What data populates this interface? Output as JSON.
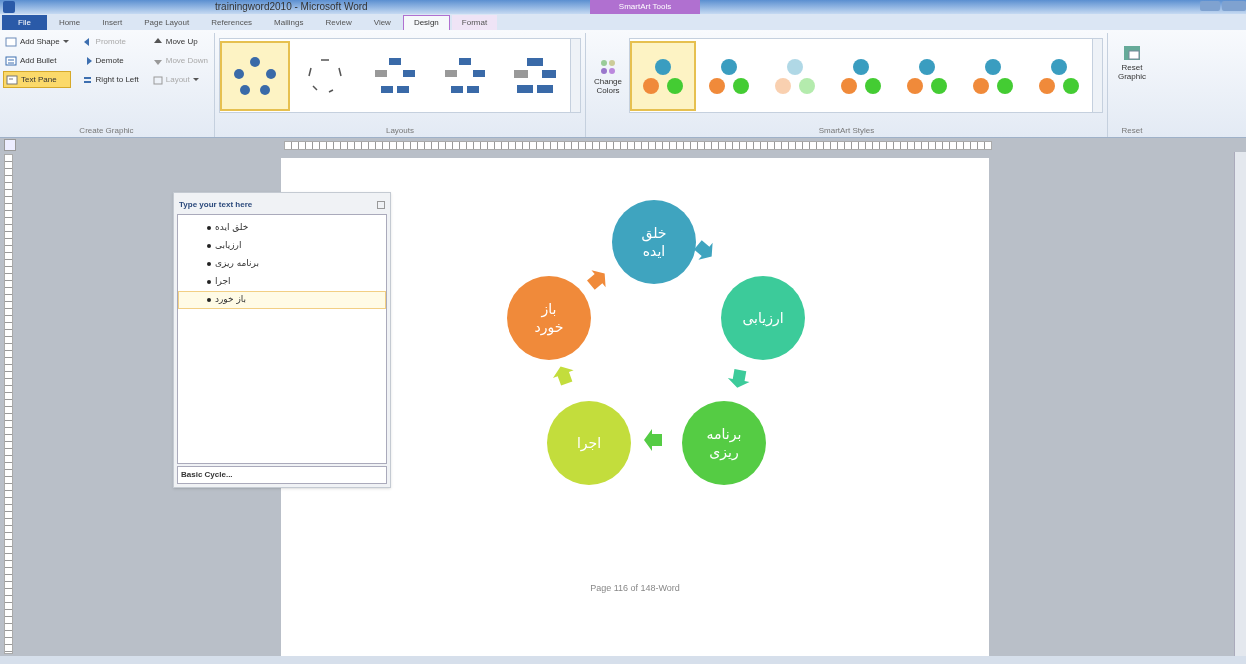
{
  "window": {
    "title": "trainingword2010 - Microsoft Word",
    "context_tab_group": "SmartArt Tools"
  },
  "tabs": [
    {
      "label": "File",
      "kind": "file",
      "selected": false
    },
    {
      "label": "Home",
      "kind": "tab",
      "selected": false
    },
    {
      "label": "Insert",
      "kind": "tab",
      "selected": false
    },
    {
      "label": "Page Layout",
      "kind": "tab",
      "selected": false
    },
    {
      "label": "References",
      "kind": "tab",
      "selected": false
    },
    {
      "label": "Mailings",
      "kind": "tab",
      "selected": false
    },
    {
      "label": "Review",
      "kind": "tab",
      "selected": false
    },
    {
      "label": "View",
      "kind": "tab",
      "selected": false
    },
    {
      "label": "Design",
      "kind": "context",
      "selected": true
    },
    {
      "label": "Format",
      "kind": "context",
      "selected": false
    }
  ],
  "ribbon": {
    "create_graphic": {
      "label": "Create Graphic",
      "columns": [
        [
          {
            "label": "Add Shape",
            "dropdown": true,
            "disabled": false,
            "selected": false
          },
          {
            "label": "Add Bullet",
            "dropdown": false,
            "disabled": false,
            "selected": false
          },
          {
            "label": "Text Pane",
            "dropdown": false,
            "disabled": false,
            "selected": true
          }
        ],
        [
          {
            "label": "Promote",
            "dropdown": false,
            "disabled": true,
            "selected": false
          },
          {
            "label": "Demote",
            "dropdown": false,
            "disabled": false,
            "selected": false
          },
          {
            "label": "Right to Left",
            "dropdown": false,
            "disabled": false,
            "selected": false
          }
        ],
        [
          {
            "label": "Move Up",
            "dropdown": false,
            "disabled": false,
            "selected": false
          },
          {
            "label": "Move Down",
            "dropdown": false,
            "disabled": true,
            "selected": false
          },
          {
            "label": "Layout",
            "dropdown": true,
            "disabled": true,
            "selected": false
          }
        ]
      ]
    },
    "layouts": {
      "label": "Layouts",
      "items": [
        {
          "kind": "cycle",
          "selected": true
        },
        {
          "kind": "arrows",
          "selected": false
        },
        {
          "kind": "blocks",
          "selected": false
        },
        {
          "kind": "blocks",
          "selected": false
        },
        {
          "kind": "wide",
          "selected": false
        }
      ]
    },
    "styles": {
      "label": "SmartArt Styles",
      "change_colors": "Change Colors",
      "items": [
        {
          "kind": "flat",
          "selected": true
        },
        {
          "kind": "flat",
          "selected": false
        },
        {
          "kind": "pale",
          "selected": false
        },
        {
          "kind": "flat",
          "selected": false
        },
        {
          "kind": "flat",
          "selected": false
        },
        {
          "kind": "flat",
          "selected": false
        },
        {
          "kind": "flat",
          "selected": false
        }
      ]
    },
    "reset": {
      "label": "Reset",
      "button": "Reset Graphic"
    }
  },
  "text_pane": {
    "title": "Type your text here",
    "items": [
      {
        "text": "خلق ایده",
        "selected": false
      },
      {
        "text": "ارزیابی",
        "selected": false
      },
      {
        "text": "برنامه ریزی",
        "selected": false
      },
      {
        "text": "اجرا",
        "selected": false
      },
      {
        "text": "باز خورد",
        "selected": true
      }
    ],
    "footer": "Basic Cycle..."
  },
  "diagram": {
    "nodes": [
      {
        "lines": [
          "خلق",
          "ایده"
        ],
        "color": "#3fa4bf"
      },
      {
        "lines": [
          "ارزیابی"
        ],
        "color": "#3ccb9a"
      },
      {
        "lines": [
          "برنامه",
          "ریزی"
        ],
        "color": "#55cc44"
      },
      {
        "lines": [
          "اجرا"
        ],
        "color": "#c3dd3c"
      },
      {
        "lines": [
          "باز",
          "خورد"
        ],
        "color": "#f08a3a"
      }
    ]
  },
  "page_footer": "Page 116 of 148-Word"
}
